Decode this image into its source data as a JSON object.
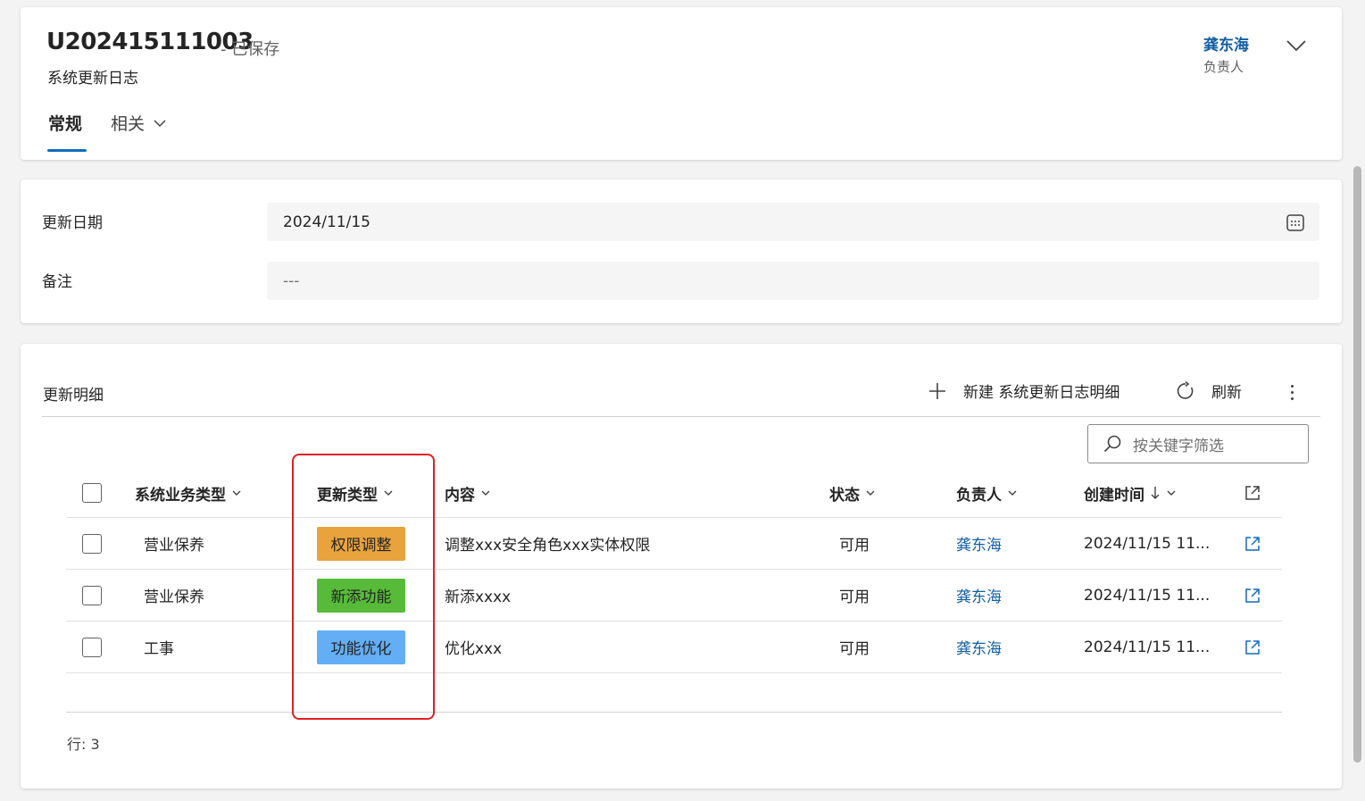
{
  "header": {
    "record_id": "U202415111003",
    "saved_status": "- 已保存",
    "entity_name": "系统更新日志",
    "owner_name": "龚东海",
    "owner_label": "负责人",
    "tabs": [
      {
        "label": "常规",
        "selected": true
      },
      {
        "label": "相关",
        "selected": false
      }
    ]
  },
  "form": {
    "update_date_label": "更新日期",
    "update_date_value": "2024/11/15",
    "notes_label": "备注",
    "notes_value": "---"
  },
  "subgrid": {
    "title": "更新明细",
    "new_label": "新建 系统更新日志明细",
    "refresh_label": "刷新",
    "search_placeholder": "按关键字筛选",
    "columns": {
      "biz_type": "系统业务类型",
      "update_type": "更新类型",
      "content": "内容",
      "status": "状态",
      "owner": "负责人",
      "created": "创建时间"
    },
    "rows": [
      {
        "biz_type": "营业保养",
        "update_type": "权限调整",
        "content": "调整xxx安全角色xxx实体权限",
        "status": "可用",
        "owner": "龚东海",
        "created": "2024/11/15 11..."
      },
      {
        "biz_type": "营业保养",
        "update_type": "新添功能",
        "content": "新添xxxx",
        "status": "可用",
        "owner": "龚东海",
        "created": "2024/11/15 11..."
      },
      {
        "biz_type": "工事",
        "update_type": "功能优化",
        "content": "优化xxx",
        "status": "可用",
        "owner": "龚东海",
        "created": "2024/11/15 11..."
      }
    ],
    "row_count_label": "行: 3"
  },
  "colors": {
    "accent": "#0f6cbd",
    "link": "#115ea3",
    "tag_permission": "#e8a33d",
    "tag_new_feature": "#57bb39",
    "tag_optimization": "#63aef5",
    "highlight": "#e02020"
  }
}
